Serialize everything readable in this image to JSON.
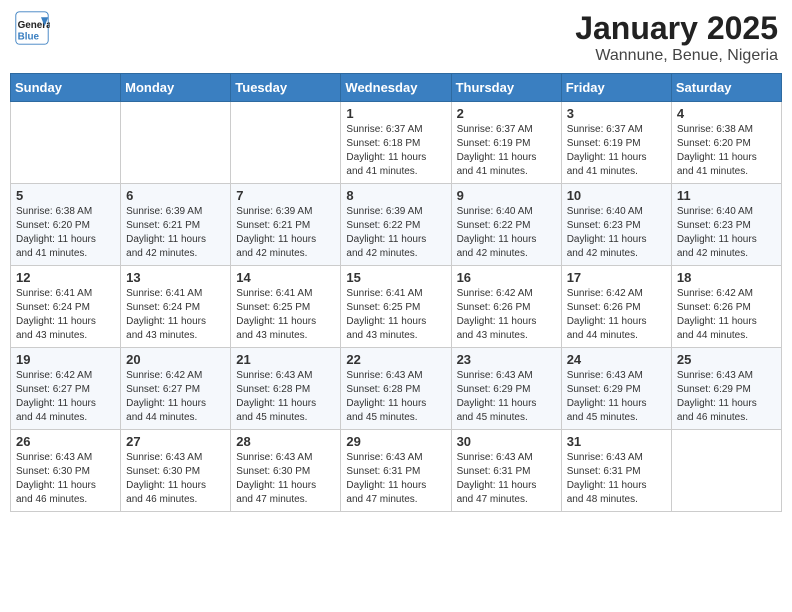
{
  "header": {
    "logo_line1": "General",
    "logo_line2": "Blue",
    "title": "January 2025",
    "subtitle": "Wannune, Benue, Nigeria"
  },
  "days_of_week": [
    "Sunday",
    "Monday",
    "Tuesday",
    "Wednesday",
    "Thursday",
    "Friday",
    "Saturday"
  ],
  "weeks": [
    [
      {
        "day": "",
        "info": ""
      },
      {
        "day": "",
        "info": ""
      },
      {
        "day": "",
        "info": ""
      },
      {
        "day": "1",
        "info": "Sunrise: 6:37 AM\nSunset: 6:18 PM\nDaylight: 11 hours and 41 minutes."
      },
      {
        "day": "2",
        "info": "Sunrise: 6:37 AM\nSunset: 6:19 PM\nDaylight: 11 hours and 41 minutes."
      },
      {
        "day": "3",
        "info": "Sunrise: 6:37 AM\nSunset: 6:19 PM\nDaylight: 11 hours and 41 minutes."
      },
      {
        "day": "4",
        "info": "Sunrise: 6:38 AM\nSunset: 6:20 PM\nDaylight: 11 hours and 41 minutes."
      }
    ],
    [
      {
        "day": "5",
        "info": "Sunrise: 6:38 AM\nSunset: 6:20 PM\nDaylight: 11 hours and 41 minutes."
      },
      {
        "day": "6",
        "info": "Sunrise: 6:39 AM\nSunset: 6:21 PM\nDaylight: 11 hours and 42 minutes."
      },
      {
        "day": "7",
        "info": "Sunrise: 6:39 AM\nSunset: 6:21 PM\nDaylight: 11 hours and 42 minutes."
      },
      {
        "day": "8",
        "info": "Sunrise: 6:39 AM\nSunset: 6:22 PM\nDaylight: 11 hours and 42 minutes."
      },
      {
        "day": "9",
        "info": "Sunrise: 6:40 AM\nSunset: 6:22 PM\nDaylight: 11 hours and 42 minutes."
      },
      {
        "day": "10",
        "info": "Sunrise: 6:40 AM\nSunset: 6:23 PM\nDaylight: 11 hours and 42 minutes."
      },
      {
        "day": "11",
        "info": "Sunrise: 6:40 AM\nSunset: 6:23 PM\nDaylight: 11 hours and 42 minutes."
      }
    ],
    [
      {
        "day": "12",
        "info": "Sunrise: 6:41 AM\nSunset: 6:24 PM\nDaylight: 11 hours and 43 minutes."
      },
      {
        "day": "13",
        "info": "Sunrise: 6:41 AM\nSunset: 6:24 PM\nDaylight: 11 hours and 43 minutes."
      },
      {
        "day": "14",
        "info": "Sunrise: 6:41 AM\nSunset: 6:25 PM\nDaylight: 11 hours and 43 minutes."
      },
      {
        "day": "15",
        "info": "Sunrise: 6:41 AM\nSunset: 6:25 PM\nDaylight: 11 hours and 43 minutes."
      },
      {
        "day": "16",
        "info": "Sunrise: 6:42 AM\nSunset: 6:26 PM\nDaylight: 11 hours and 43 minutes."
      },
      {
        "day": "17",
        "info": "Sunrise: 6:42 AM\nSunset: 6:26 PM\nDaylight: 11 hours and 44 minutes."
      },
      {
        "day": "18",
        "info": "Sunrise: 6:42 AM\nSunset: 6:26 PM\nDaylight: 11 hours and 44 minutes."
      }
    ],
    [
      {
        "day": "19",
        "info": "Sunrise: 6:42 AM\nSunset: 6:27 PM\nDaylight: 11 hours and 44 minutes."
      },
      {
        "day": "20",
        "info": "Sunrise: 6:42 AM\nSunset: 6:27 PM\nDaylight: 11 hours and 44 minutes."
      },
      {
        "day": "21",
        "info": "Sunrise: 6:43 AM\nSunset: 6:28 PM\nDaylight: 11 hours and 45 minutes."
      },
      {
        "day": "22",
        "info": "Sunrise: 6:43 AM\nSunset: 6:28 PM\nDaylight: 11 hours and 45 minutes."
      },
      {
        "day": "23",
        "info": "Sunrise: 6:43 AM\nSunset: 6:29 PM\nDaylight: 11 hours and 45 minutes."
      },
      {
        "day": "24",
        "info": "Sunrise: 6:43 AM\nSunset: 6:29 PM\nDaylight: 11 hours and 45 minutes."
      },
      {
        "day": "25",
        "info": "Sunrise: 6:43 AM\nSunset: 6:29 PM\nDaylight: 11 hours and 46 minutes."
      }
    ],
    [
      {
        "day": "26",
        "info": "Sunrise: 6:43 AM\nSunset: 6:30 PM\nDaylight: 11 hours and 46 minutes."
      },
      {
        "day": "27",
        "info": "Sunrise: 6:43 AM\nSunset: 6:30 PM\nDaylight: 11 hours and 46 minutes."
      },
      {
        "day": "28",
        "info": "Sunrise: 6:43 AM\nSunset: 6:30 PM\nDaylight: 11 hours and 47 minutes."
      },
      {
        "day": "29",
        "info": "Sunrise: 6:43 AM\nSunset: 6:31 PM\nDaylight: 11 hours and 47 minutes."
      },
      {
        "day": "30",
        "info": "Sunrise: 6:43 AM\nSunset: 6:31 PM\nDaylight: 11 hours and 47 minutes."
      },
      {
        "day": "31",
        "info": "Sunrise: 6:43 AM\nSunset: 6:31 PM\nDaylight: 11 hours and 48 minutes."
      },
      {
        "day": "",
        "info": ""
      }
    ]
  ]
}
